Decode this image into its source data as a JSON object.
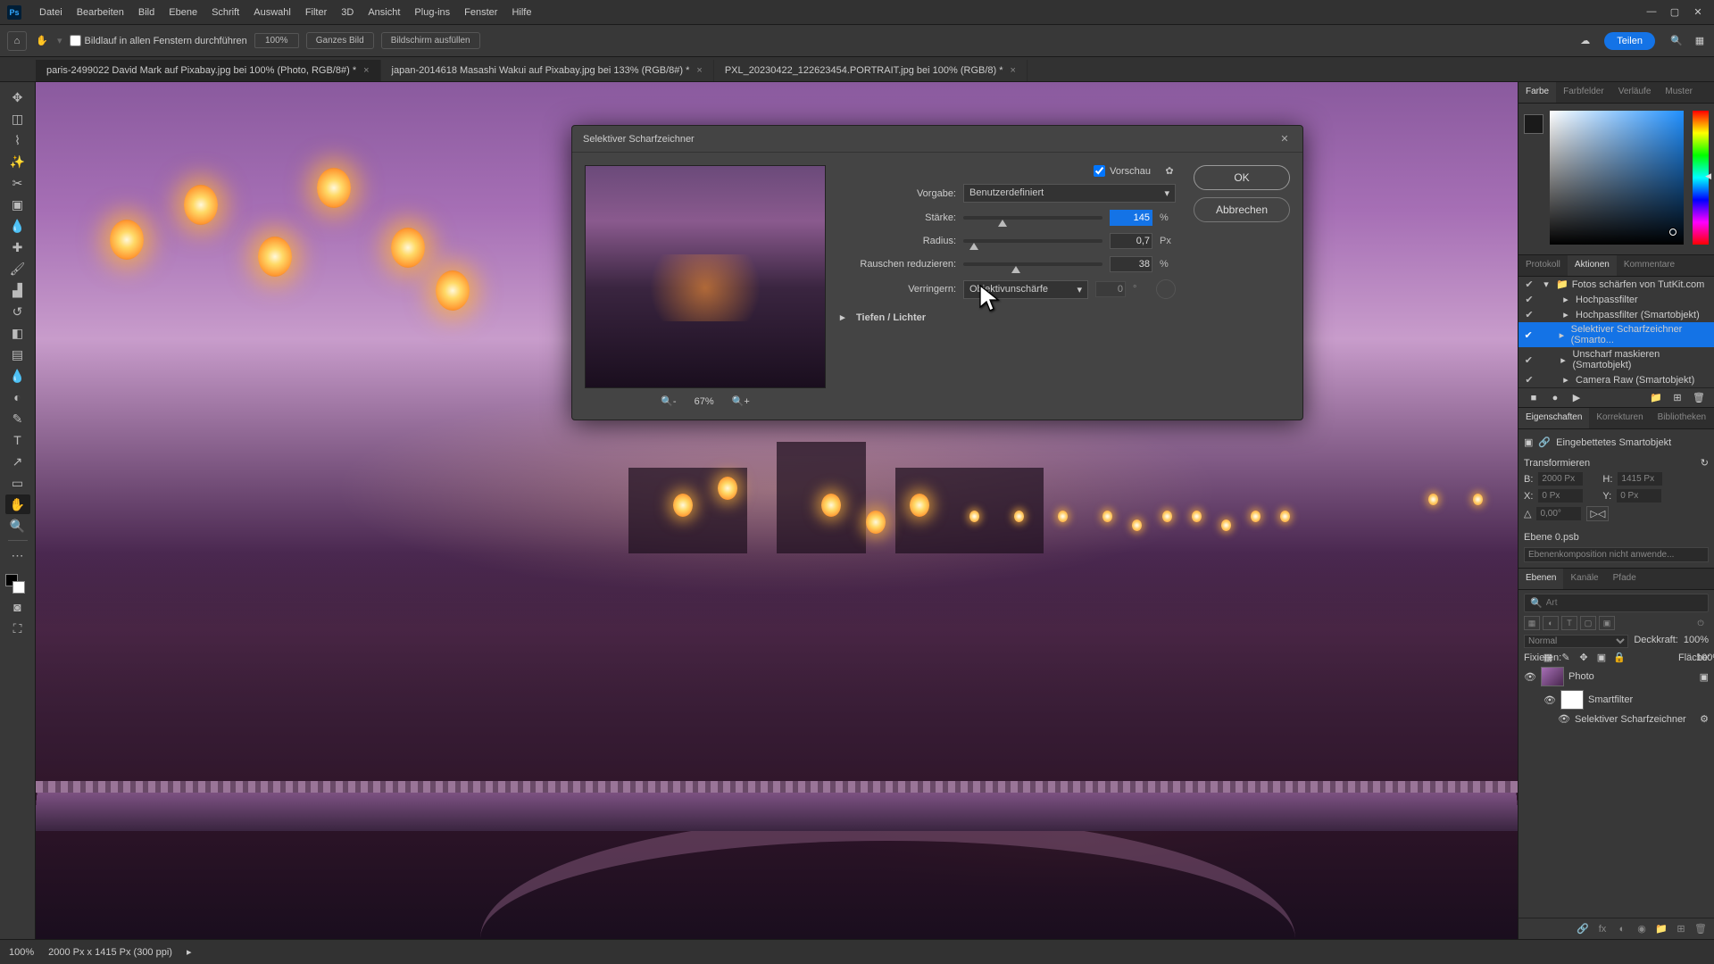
{
  "app": {
    "logo": "Ps"
  },
  "menu": [
    "Datei",
    "Bearbeiten",
    "Bild",
    "Ebene",
    "Schrift",
    "Auswahl",
    "Filter",
    "3D",
    "Ansicht",
    "Plug-ins",
    "Fenster",
    "Hilfe"
  ],
  "window_controls": {
    "min": "—",
    "max": "▢",
    "close": "✕"
  },
  "options": {
    "scroll_all": "Bildlauf in allen Fenstern durchführen",
    "zoom": "100%",
    "fit_screen": "Ganzes Bild",
    "fill_screen": "Bildschirm ausfüllen",
    "share": "Teilen"
  },
  "tabs": [
    {
      "label": "paris-2499022  David Mark auf Pixabay.jpg bei 100% (Photo, RGB/8#) *",
      "active": true
    },
    {
      "label": "japan-2014618 Masashi Wakui auf Pixabay.jpg bei 133% (RGB/8#) *",
      "active": false
    },
    {
      "label": "PXL_20230422_122623454.PORTRAIT.jpg bei 100% (RGB/8) *",
      "active": false
    }
  ],
  "dialog": {
    "title": "Selektiver Scharfzeichner",
    "preview_label": "Vorschau",
    "preset_label": "Vorgabe:",
    "preset_value": "Benutzerdefiniert",
    "amount_label": "Stärke:",
    "amount_value": "145",
    "amount_unit": "%",
    "radius_label": "Radius:",
    "radius_value": "0,7",
    "radius_unit": "Px",
    "noise_label": "Rauschen reduzieren:",
    "noise_value": "38",
    "noise_unit": "%",
    "remove_label": "Verringern:",
    "remove_value": "Objektivunschärfe",
    "remove_degree": "0",
    "remove_degree_unit": "°",
    "section": "Tiefen / Lichter",
    "ok": "OK",
    "cancel": "Abbrechen",
    "zoom": "67%"
  },
  "panels": {
    "color_tabs": [
      "Farbe",
      "Farbfelder",
      "Verläufe",
      "Muster"
    ],
    "actions_tabs": [
      "Protokoll",
      "Aktionen",
      "Kommentare"
    ],
    "actions": {
      "folder": "Fotos schärfen von TutKit.com",
      "items": [
        "Hochpassfilter",
        "Hochpassfilter (Smartobjekt)",
        "Selektiver Scharfzeichner (Smarto...",
        "Unscharf maskieren (Smartobjekt)",
        "Camera Raw (Smartobjekt)"
      ]
    },
    "props_tabs": [
      "Eigenschaften",
      "Korrekturen",
      "Bibliotheken"
    ],
    "props": {
      "type": "Eingebettetes Smartobjekt",
      "transform": "Transformieren",
      "w_label": "B:",
      "w_val": "2000 Px",
      "h_label": "H:",
      "h_val": "1415 Px",
      "x_label": "X:",
      "x_val": "0 Px",
      "y_label": "Y:",
      "y_val": "0 Px",
      "layer": "Ebene 0.psb",
      "comp_ph": "Ebenenkomposition nicht anwende..."
    },
    "layers_tabs": [
      "Ebenen",
      "Kanäle",
      "Pfade"
    ],
    "layers": {
      "search_ph": "Art",
      "mode": "Normal",
      "opacity_label": "Deckkraft:",
      "opacity": "100%",
      "lock_label": "Fixieren:",
      "fill_label": "Fläche:",
      "fill": "100%",
      "items": [
        {
          "name": "Photo"
        },
        {
          "name": "Smartfilter"
        },
        {
          "name": "Selektiver Scharfzeichner"
        }
      ]
    }
  },
  "status": {
    "zoom": "100%",
    "info": "2000 Px x 1415 Px (300 ppi)"
  }
}
